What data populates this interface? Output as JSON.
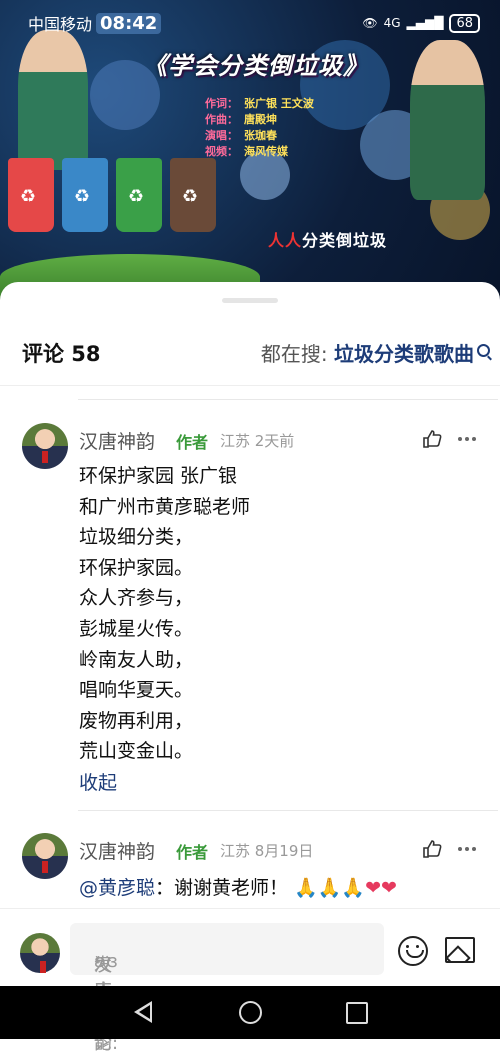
{
  "status_bar": {
    "carrier": "中国移动",
    "time": "08:42",
    "network": "4G",
    "battery": "68"
  },
  "video": {
    "song_title": "《学会分类倒垃圾》",
    "credits": [
      {
        "role": "作词：",
        "name": "张广银 王文波"
      },
      {
        "role": "作曲：",
        "name": "唐殿坤"
      },
      {
        "role": "演唱：",
        "name": "张珈春"
      },
      {
        "role": "视频：",
        "name": "海风传媒"
      }
    ],
    "slogan_red": "人人",
    "slogan_rest": "分类倒垃圾"
  },
  "header": {
    "comments_label": "评论 58",
    "searching_label": "都在搜:",
    "searching_query": "垃圾分类歌歌曲"
  },
  "comments": [
    {
      "user": "汉唐神韵",
      "badge": "作者",
      "meta": "江苏 2天前",
      "lines": [
        "环保护家园  张广银",
        "和广州市黄彦聪老师",
        "垃圾细分类，",
        "环保护家园。",
        "众人齐参与，",
        "彭城星火传。",
        "岭南友人助，",
        "唱响华夏天。",
        "废物再利用，",
        "荒山变金山。"
      ],
      "collapse_label": "收起"
    },
    {
      "user": "汉唐神韵",
      "badge": "作者",
      "meta": "江苏 8月19日",
      "mention": "@黄彦聪",
      "text": "：谢谢黄老师！",
      "emojis": "🙏🙏🙏",
      "hearts": "❤❤"
    }
  ],
  "input_bar": {
    "placeholder_user": "汉唐神韵",
    "placeholder_rest": " 发表评论:"
  },
  "colors": {
    "link": "#1d3c78",
    "author_badge": "#3a9a3a",
    "meta": "#999999"
  }
}
